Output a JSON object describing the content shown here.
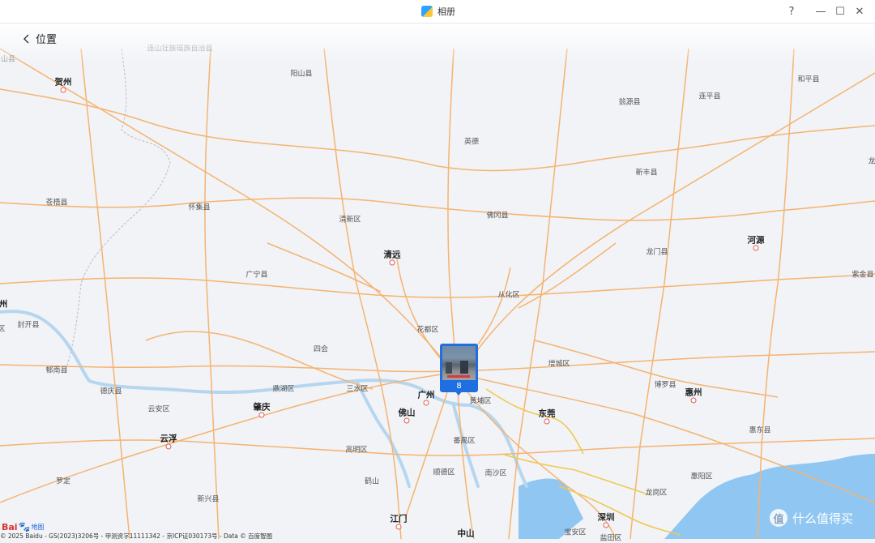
{
  "window": {
    "app_title": "相册",
    "help_icon": "?",
    "minimize_icon": "—",
    "maximize_icon": "☐",
    "close_icon": "✕"
  },
  "header": {
    "back_label": "位置"
  },
  "map": {
    "provider": "Baidu",
    "cities": [
      {
        "name": "贺州"
      },
      {
        "name": "清远"
      },
      {
        "name": "肇庆"
      },
      {
        "name": "云浮"
      },
      {
        "name": "广州"
      },
      {
        "name": "佛山"
      },
      {
        "name": "东莞"
      },
      {
        "name": "惠州"
      },
      {
        "name": "河源"
      },
      {
        "name": "江门"
      },
      {
        "name": "深圳"
      },
      {
        "name": "中山"
      },
      {
        "name": "州"
      }
    ],
    "places": [
      {
        "name": "连山壮族瑶族自治县"
      },
      {
        "name": "山县"
      },
      {
        "name": "阳山县"
      },
      {
        "name": "和平县"
      },
      {
        "name": "翁源县"
      },
      {
        "name": "连平县"
      },
      {
        "name": "英德"
      },
      {
        "name": "新丰县"
      },
      {
        "name": "苍梧县"
      },
      {
        "name": "怀集县"
      },
      {
        "name": "清新区"
      },
      {
        "name": "佛冈县"
      },
      {
        "name": "广宁县"
      },
      {
        "name": "龙门县"
      },
      {
        "name": "紫金县"
      },
      {
        "name": "从化区"
      },
      {
        "name": "封开县"
      },
      {
        "name": "花都区"
      },
      {
        "name": "四会"
      },
      {
        "name": "增城区"
      },
      {
        "name": "郁南县"
      },
      {
        "name": "德庆县"
      },
      {
        "name": "鼎湖区"
      },
      {
        "name": "三水区"
      },
      {
        "name": "黄埔区"
      },
      {
        "name": "博罗县"
      },
      {
        "name": "云安区"
      },
      {
        "name": "惠东县"
      },
      {
        "name": "高明区"
      },
      {
        "name": "番禺区"
      },
      {
        "name": "顺德区"
      },
      {
        "name": "南沙区"
      },
      {
        "name": "惠阳区"
      },
      {
        "name": "罗定"
      },
      {
        "name": "鹤山"
      },
      {
        "name": "新兴县"
      },
      {
        "name": "龙岗区"
      },
      {
        "name": "宝安区"
      },
      {
        "name": "盐田区"
      },
      {
        "name": "区"
      },
      {
        "name": "龙"
      }
    ],
    "marker": {
      "count": "8"
    },
    "logo_text": "Bai",
    "logo_paw": "🐾",
    "logo_suffix": "地图",
    "copyright": "© 2025 Baidu - GS(2023)3206号 - 甲测资字11111342 - 京ICP证030173号 - Data © 百度智图"
  },
  "watermark": {
    "icon_text": "值",
    "text": "什么值得买"
  }
}
